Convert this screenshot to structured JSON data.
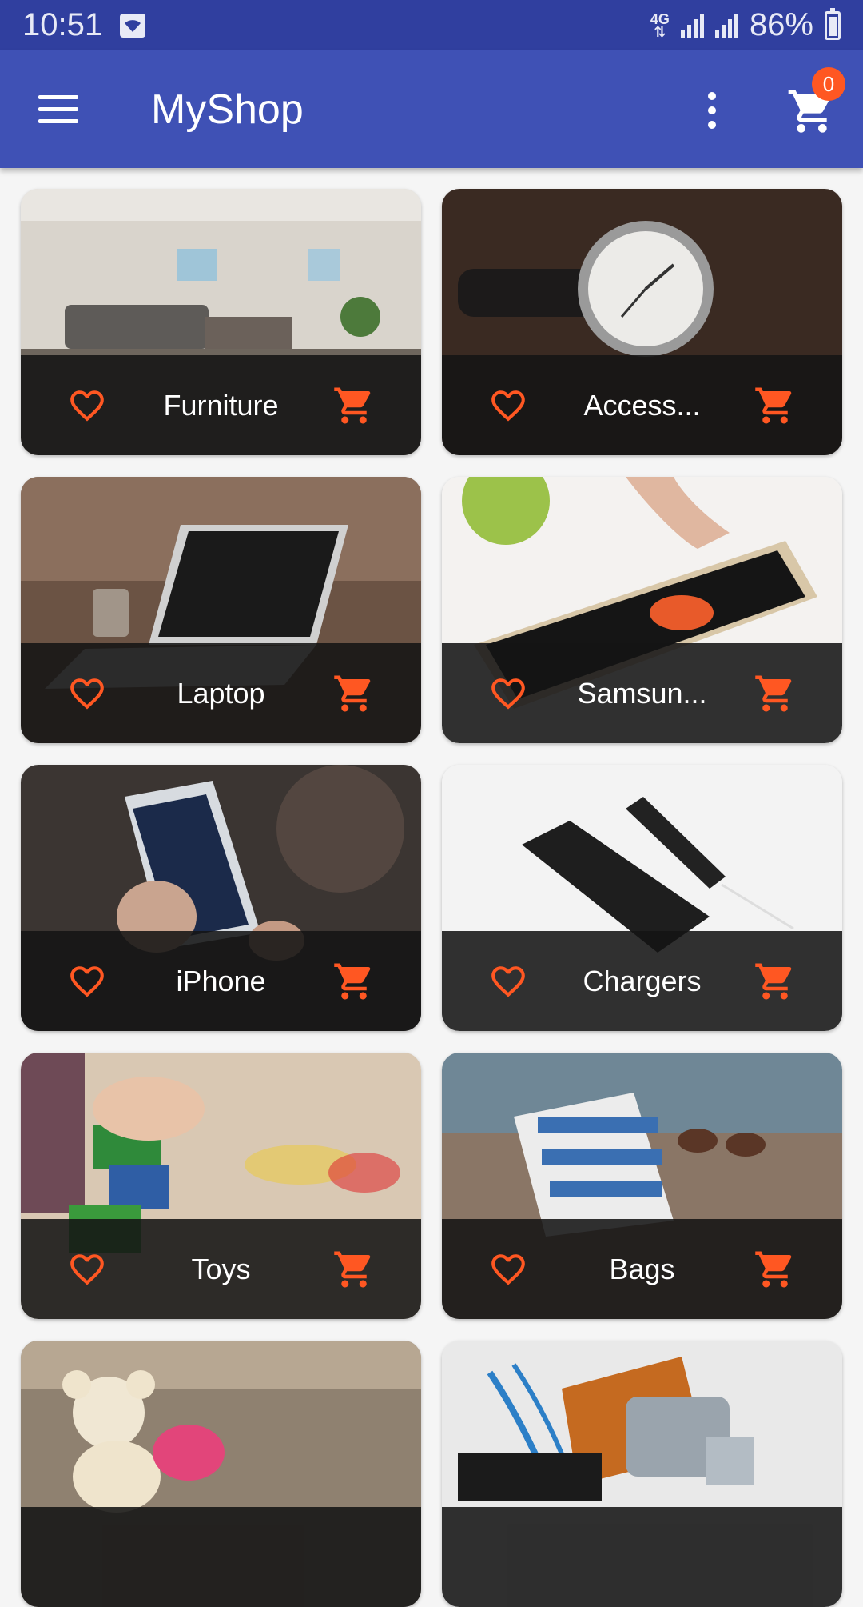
{
  "status_bar": {
    "time": "10:51",
    "network": "4G",
    "battery": "86%"
  },
  "app_bar": {
    "title": "MyShop",
    "cart_count": "0"
  },
  "colors": {
    "primary": "#3f51b5",
    "primary_dark": "#303f9f",
    "accent": "#ff5722"
  },
  "categories": [
    {
      "label": "Furniture"
    },
    {
      "label": "Access..."
    },
    {
      "label": "Laptop"
    },
    {
      "label": "Samsun..."
    },
    {
      "label": "iPhone"
    },
    {
      "label": "Chargers"
    },
    {
      "label": "Toys"
    },
    {
      "label": "Bags"
    },
    {
      "label": ""
    },
    {
      "label": ""
    }
  ]
}
